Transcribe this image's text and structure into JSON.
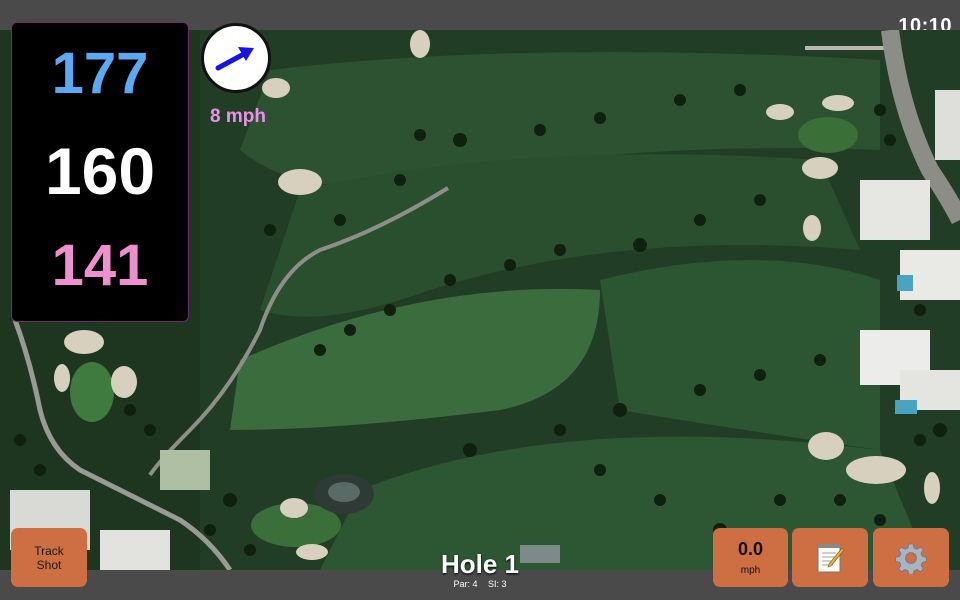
{
  "status_bar": {
    "time": "10:10"
  },
  "distances": {
    "back": "177",
    "middle": "160",
    "front": "141"
  },
  "wind": {
    "speed_label": "8 mph",
    "direction_icon": "arrow-right-icon"
  },
  "buttons": {
    "track_shot": {
      "line1": "Track",
      "line2": "Shot"
    },
    "speed": {
      "value": "0.0",
      "unit": "mph"
    },
    "notes_icon": "notepad-icon",
    "settings_icon": "gear-icon"
  },
  "hole": {
    "title": "Hole 1",
    "par_label": "Par: 4",
    "si_label": "SI: 3"
  },
  "colors": {
    "back_distance": "#5aa9f2",
    "middle_distance": "#ffffff",
    "front_distance": "#ee8fcf",
    "wind_text": "#ee8fea",
    "button": "#cd6f43"
  }
}
